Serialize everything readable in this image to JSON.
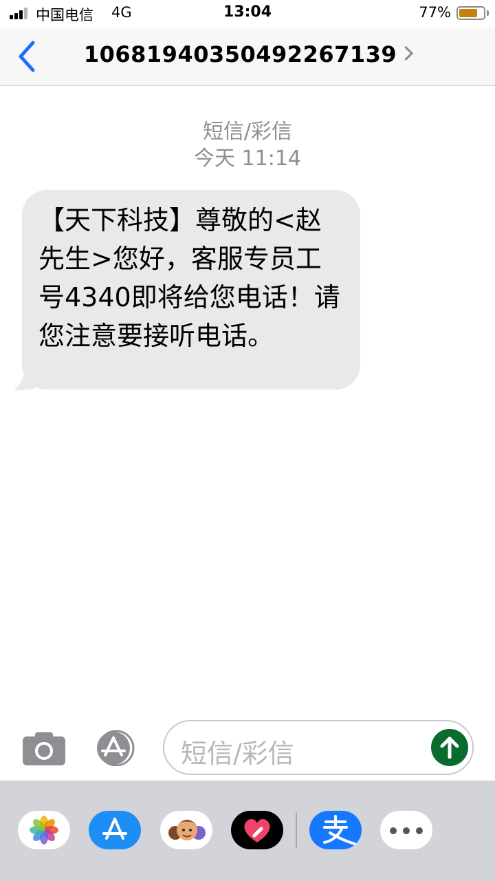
{
  "status_bar": {
    "carrier": "中国电信",
    "network": "4G",
    "time": "13:04",
    "battery_percent": "77%",
    "battery_level": 0.77,
    "battery_color": "#c7800b"
  },
  "nav": {
    "back_icon": "chevron-left-icon",
    "contact": "1068194035049226713​9",
    "contact_detail_icon": "chevron-right-icon"
  },
  "conversation": {
    "message_type": "短信/彩信",
    "timestamp": "今天 11:14",
    "messages": [
      {
        "direction": "incoming",
        "text": "【天下科技】尊敬的<赵先生>您好，客服专员工号4340即将给您电话！请您注意要接听电话。"
      }
    ]
  },
  "composer": {
    "camera_icon": "camera-icon",
    "apps_icon": "app-store-icon",
    "placeholder": "短信/彩信",
    "send_icon": "send-arrow-icon",
    "send_color": "#0a6b2f"
  },
  "app_drawer": {
    "apps": [
      {
        "name": "photos-icon"
      },
      {
        "name": "app-store-icon"
      },
      {
        "name": "memoji-icon"
      },
      {
        "name": "digital-touch-icon"
      },
      {
        "name": "alipay-icon"
      },
      {
        "name": "more-icon"
      }
    ]
  },
  "colors": {
    "accent": "#1a6dff",
    "bubble_gray": "#e9e9eb",
    "secondary_text": "#8e8e93"
  }
}
